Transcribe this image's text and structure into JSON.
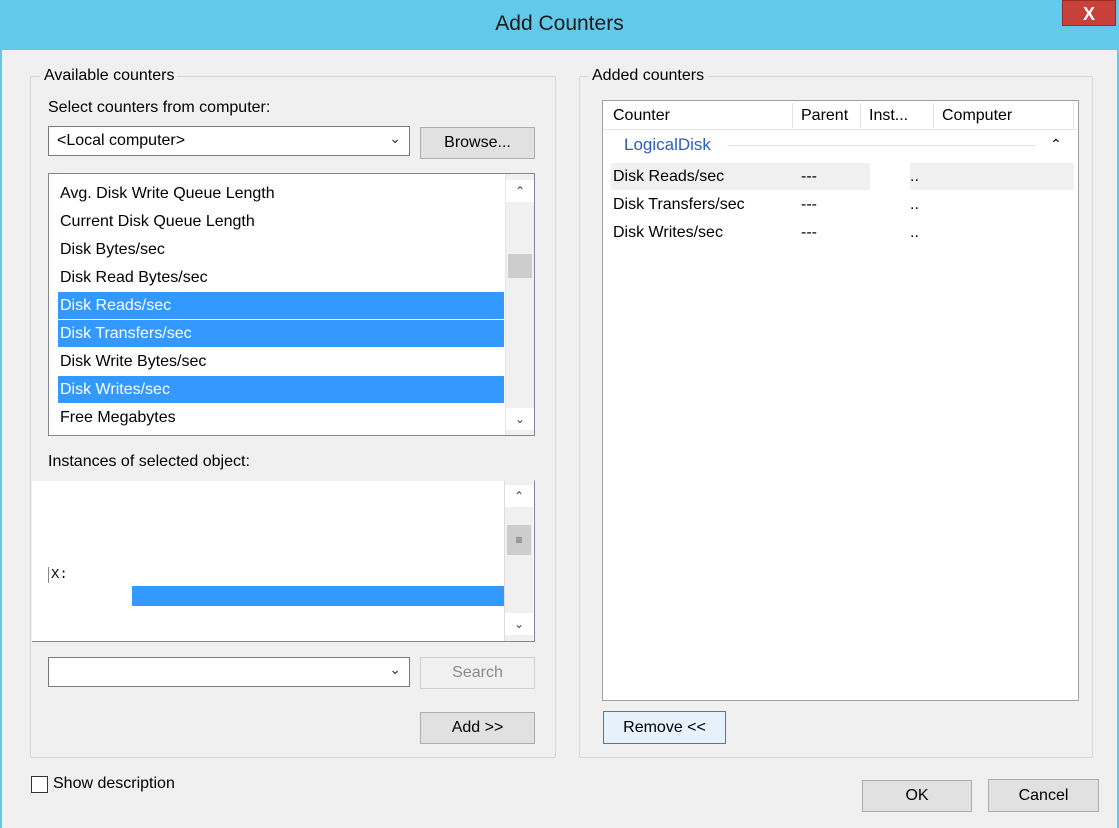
{
  "window": {
    "title": "Add Counters",
    "close_label": "X"
  },
  "available": {
    "group_label": "Available counters",
    "select_label": "Select counters from computer:",
    "computer_value": "<Local computer>",
    "browse_label": "Browse...",
    "counters": [
      {
        "label": "Avg. Disk Write Queue Length",
        "selected": false
      },
      {
        "label": "Current Disk Queue Length",
        "selected": false
      },
      {
        "label": "Disk Bytes/sec",
        "selected": false
      },
      {
        "label": "Disk Read Bytes/sec",
        "selected": false
      },
      {
        "label": "Disk Reads/sec",
        "selected": true
      },
      {
        "label": "Disk Transfers/sec",
        "selected": true
      },
      {
        "label": "Disk Write Bytes/sec",
        "selected": false
      },
      {
        "label": "Disk Writes/sec",
        "selected": true
      },
      {
        "label": "Free Megabytes",
        "selected": false
      }
    ],
    "instances_label": "Instances of selected object:",
    "instances": [
      "X:"
    ],
    "search_label": "Search",
    "add_label": "Add >>"
  },
  "added": {
    "group_label": "Added counters",
    "columns": [
      "Counter",
      "Parent",
      "Inst...",
      "Computer"
    ],
    "group_name": "LogicalDisk",
    "rows": [
      {
        "counter": "Disk Reads/sec",
        "parent": "---",
        "instance": "..",
        "computer": ""
      },
      {
        "counter": "Disk Transfers/sec",
        "parent": "---",
        "instance": "..",
        "computer": ""
      },
      {
        "counter": "Disk Writes/sec",
        "parent": "---",
        "instance": "..",
        "computer": ""
      }
    ],
    "remove_label": "Remove <<"
  },
  "footer": {
    "show_description_label": "Show description",
    "show_description_checked": false,
    "ok_label": "OK",
    "cancel_label": "Cancel"
  },
  "colors": {
    "title_bar": "#63c9eb",
    "selection": "#3399ff",
    "close_button": "#c7403a",
    "group_header": "#2f5dbb"
  }
}
